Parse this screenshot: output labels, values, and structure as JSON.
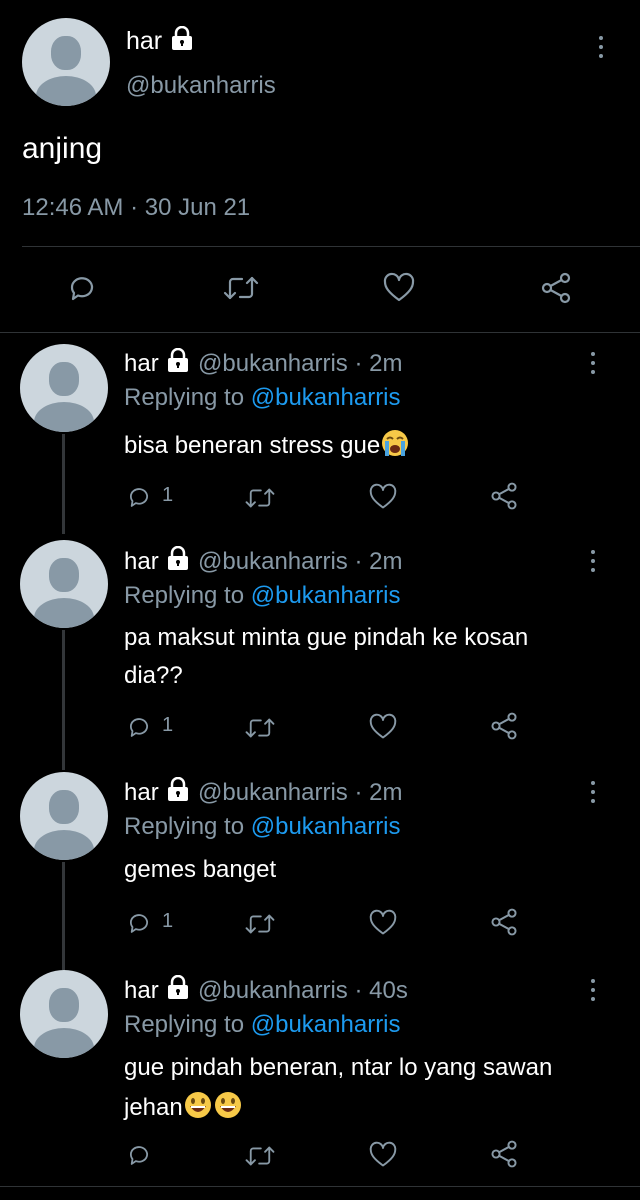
{
  "main_tweet": {
    "name": "har",
    "handle": "@bukanharris",
    "text": "anjing",
    "timestamp": "12:46 AM · 30 Jun 21"
  },
  "replies": [
    {
      "name": "har",
      "handle": "@bukanharris · 2m",
      "replying_label": "Replying to",
      "replying_to": "@bukanharris",
      "text_line1": "bisa beneran stress gue",
      "text_line2": "",
      "reply_count": "1"
    },
    {
      "name": "har",
      "handle": "@bukanharris · 2m",
      "replying_label": "Replying to",
      "replying_to": "@bukanharris",
      "text_line1": "pa maksut minta gue pindah ke kosan",
      "text_line2": "dia??",
      "reply_count": "1"
    },
    {
      "name": "har",
      "handle": "@bukanharris · 2m",
      "replying_label": "Replying to",
      "replying_to": "@bukanharris",
      "text_line1": "gemes banget",
      "text_line2": "",
      "reply_count": "1"
    },
    {
      "name": "har",
      "handle": "@bukanharris · 40s",
      "replying_label": "Replying to",
      "replying_to": "@bukanharris",
      "text_line1": "gue pindah beneran, ntar lo yang sawan",
      "text_line2": "jehan",
      "reply_count": ""
    }
  ],
  "colors": {
    "background": "#000000",
    "muted": "#8899a6",
    "link": "#1d9bf0",
    "divider": "#2f3336"
  }
}
